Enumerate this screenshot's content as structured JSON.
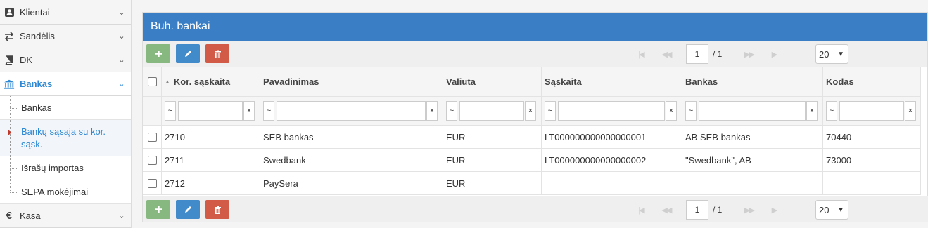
{
  "sidebar": {
    "items": [
      {
        "label": "Klientai",
        "icon": "user-icon"
      },
      {
        "label": "Sandėlis",
        "icon": "swap-icon"
      },
      {
        "label": "DK",
        "icon": "book-icon"
      },
      {
        "label": "Bankas",
        "icon": "bank-icon"
      },
      {
        "label": "Kasa",
        "icon": "euro-icon"
      }
    ],
    "sub_items": [
      {
        "label": "Bankas"
      },
      {
        "label": "Bankų sąsaja su kor. sąsk."
      },
      {
        "label": "Išrašų importas"
      },
      {
        "label": "SEPA mokėjimai"
      }
    ]
  },
  "panel": {
    "title": "Buh. bankai"
  },
  "pager": {
    "page": "1",
    "of": "/ 1",
    "page_size": "20"
  },
  "table": {
    "columns": [
      "Kor. sąskaita",
      "Pavadinimas",
      "Valiuta",
      "Sąskaita",
      "Bankas",
      "Kodas"
    ],
    "filter_op": "~",
    "filter_clear": "×",
    "rows": [
      [
        "2710",
        "SEB bankas",
        "EUR",
        "LT000000000000000001",
        "AB SEB bankas",
        "70440"
      ],
      [
        "2711",
        "Swedbank",
        "EUR",
        "LT000000000000000002",
        "\"Swedbank\", AB",
        "73000"
      ],
      [
        "2712",
        "PaySera",
        "EUR",
        "",
        "",
        ""
      ]
    ]
  },
  "colors": {
    "header_blue": "#3a7fc6",
    "add_green": "#87b87f",
    "edit_blue": "#428bca",
    "delete_red": "#d15b47",
    "active_link": "#2e88d4"
  }
}
